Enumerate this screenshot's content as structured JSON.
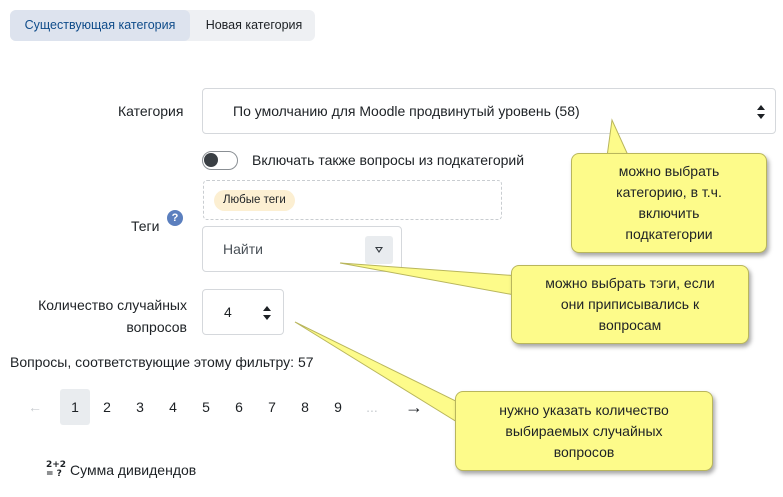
{
  "tabs": [
    {
      "label": "Существующая категория",
      "active": true
    },
    {
      "label": "Новая категория",
      "active": false
    }
  ],
  "category": {
    "label": "Категория",
    "selected": "По умолчанию для Moodle продвинутый уровень (58)"
  },
  "subcategories_toggle": {
    "label": "Включать также вопросы из подкатегорий",
    "checked": false
  },
  "tags": {
    "label": "Теги",
    "help_icon": "?",
    "selected_pill": "Любые теги",
    "search_placeholder": "Найти"
  },
  "random_count": {
    "label_line1": "Количество случайных",
    "label_line2": "вопросов",
    "value": "4"
  },
  "filter_summary": "Вопросы, соответствующие этому фильтру: 57",
  "pagination": {
    "prev": "←",
    "pages": [
      "1",
      "2",
      "3",
      "4",
      "5",
      "6",
      "7",
      "8",
      "9"
    ],
    "ellipsis": "...",
    "next": "→",
    "current": "1"
  },
  "question": {
    "icon_top": "2+2",
    "icon_bottom": "= ?",
    "title": "Сумма дивидендов"
  },
  "callouts": [
    {
      "line1": "можно выбрать",
      "line2": "категорию, в т.ч.",
      "line3": "включить",
      "line4": "подкатегории"
    },
    {
      "line1": "можно выбрать тэги, если",
      "line2": "они приписывались к",
      "line3": "вопросам"
    },
    {
      "line1": "нужно указать количество",
      "line2": "выбираемых случайных",
      "line3": "вопросов"
    }
  ],
  "colors": {
    "callout_fill": "#fdfb8a",
    "tab_active_bg": "#dde3ee",
    "tab_active_text": "#0f4c8a",
    "tag_pill_bg": "#fcefd2"
  }
}
